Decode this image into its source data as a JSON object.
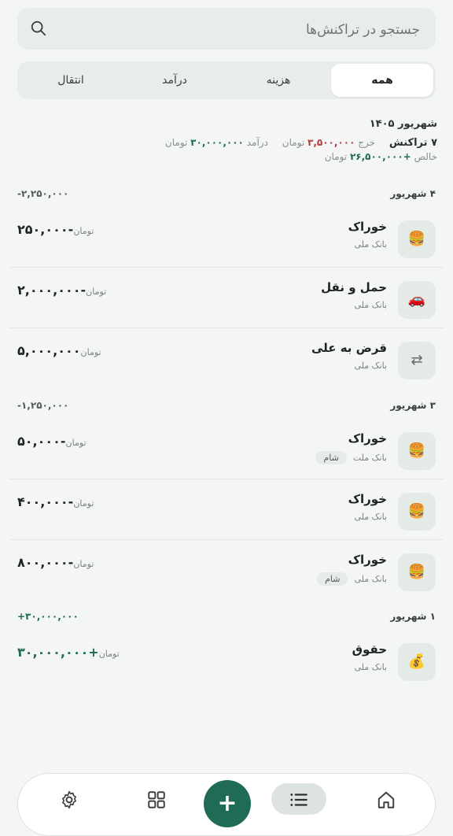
{
  "search": {
    "placeholder": "جستجو در تراکنش‌ها",
    "icon": "search-icon"
  },
  "tabs": [
    {
      "label": "همه",
      "active": true
    },
    {
      "label": "هزینه",
      "active": false
    },
    {
      "label": "درآمد",
      "active": false
    },
    {
      "label": "انتقال",
      "active": false
    }
  ],
  "summary": {
    "month": "شهریور ۱۴۰۵",
    "count": "۷ تراکنش",
    "expense_label": "خرج",
    "expense_value": "۳,۵۰۰,۰۰۰",
    "income_label": "درآمد",
    "income_value": "۳۰,۰۰۰,۰۰۰",
    "net_label": "خالص",
    "net_value": "+۲۶,۵۰۰,۰۰۰",
    "currency": "تومان"
  },
  "days": [
    {
      "label": "۴ شهریور",
      "total": "-۲,۲۵۰,۰۰۰",
      "transactions": [
        {
          "icon": "burger-icon",
          "title": "خوراک",
          "account": "بانک ملی",
          "tag": "",
          "amount": "-۲۵۰,۰۰۰",
          "currency": "تومان"
        },
        {
          "icon": "car-icon",
          "title": "حمل و نقل",
          "account": "بانک ملی",
          "tag": "",
          "amount": "-۲,۰۰۰,۰۰۰",
          "currency": "تومان"
        },
        {
          "icon": "transfer-icon",
          "title": "قرض به علی",
          "account": "بانک ملی",
          "tag": "",
          "amount": "۵,۰۰۰,۰۰۰",
          "currency": "تومان"
        }
      ]
    },
    {
      "label": "۳ شهریور",
      "total": "-۱,۲۵۰,۰۰۰",
      "transactions": [
        {
          "icon": "burger-icon",
          "title": "خوراک",
          "account": "بانک ملت",
          "tag": "شام",
          "amount": "-۵۰,۰۰۰",
          "currency": "تومان"
        },
        {
          "icon": "burger-icon",
          "title": "خوراک",
          "account": "بانک ملی",
          "tag": "",
          "amount": "-۴۰۰,۰۰۰",
          "currency": "تومان"
        },
        {
          "icon": "burger-icon",
          "title": "خوراک",
          "account": "بانک ملی",
          "tag": "شام",
          "amount": "-۸۰۰,۰۰۰",
          "currency": "تومان"
        }
      ]
    },
    {
      "label": "۱ شهریور",
      "total": "+۳۰,۰۰۰,۰۰۰",
      "transactions": [
        {
          "icon": "money-bag-icon",
          "title": "حقوق",
          "account": "بانک ملی",
          "tag": "",
          "amount": "+۳۰,۰۰۰,۰۰۰",
          "currency": "تومان"
        }
      ]
    }
  ],
  "nav": {
    "fab_label": "+",
    "items": [
      "home-icon",
      "list-icon",
      "grid-icon",
      "gear-icon"
    ],
    "active": "list-icon"
  },
  "colors": {
    "accent": "#1f6b55",
    "expense": "#b23a3a",
    "income": "#1f6b4e",
    "background": "#f3f6f4"
  }
}
